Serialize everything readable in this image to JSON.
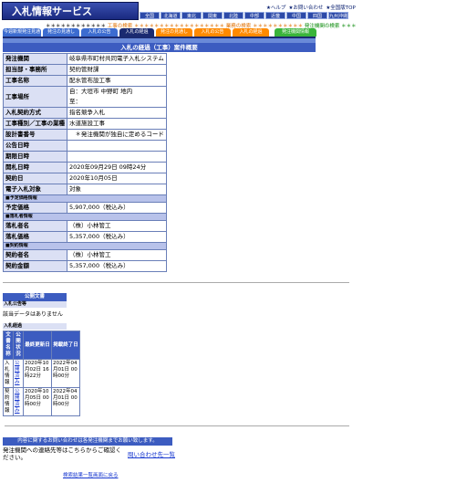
{
  "header": {
    "logo": "入札情報サービス",
    "top_links": [
      "★ヘルプ",
      "★お問い合わせ",
      "★全国版TOP"
    ],
    "regions": [
      "全国",
      "北海道",
      "東北",
      "関東",
      "北陸",
      "中部",
      "近畿",
      "中国",
      "四国",
      "九州沖縄"
    ],
    "stars_left": "＊＊＊＊＊＊＊＊＊＊＊＊",
    "stars_mid": "工事の検索",
    "stars_mid2": "＊＊＊＊＊＊＊＊＊＊＊＊＊＊＊＊＊＊",
    "stars_goods": "業務の検索",
    "stars_mid3": "＊＊＊＊＊＊＊＊＊＊",
    "stars_org": "発注機関の検索",
    "stars_end": "＊＊＊"
  },
  "tabs": [
    {
      "label": "今週新規発注見通し"
    },
    {
      "label": "発注の見通し"
    },
    {
      "label": "入札の公告"
    },
    {
      "label": "入札の経過"
    },
    {
      "label": "発注の見通し"
    },
    {
      "label": "入札の公告"
    },
    {
      "label": "入札の経過"
    },
    {
      "label": "発注機関情報"
    }
  ],
  "page_title": "入札の経過（工事）案件概要",
  "rows": {
    "agency": {
      "k": "発注機関",
      "v": "岐阜県市町村共同電子入札システム"
    },
    "dept": {
      "k": "担当部・事務所",
      "v": "契約管財課"
    },
    "name": {
      "k": "工事名称",
      "v": "配水管布設工事"
    },
    "place": {
      "k": "工事場所",
      "from": "自：大垣市 中野町 地内",
      "to": "至："
    },
    "method": {
      "k": "入札契約方式",
      "v": "指名競争入札"
    },
    "category": {
      "k": "工事種別／工事の業種",
      "v": "水道施設工事"
    },
    "design": {
      "k": "設計書番号",
      "v": "＊発注機関が独自に定めるコード"
    },
    "notice_date": {
      "k": "公告日時",
      "v": ""
    },
    "deadline": {
      "k": "期限日時",
      "v": ""
    },
    "open_date": {
      "k": "開札日時",
      "v": "2020年09月29日 09時24分"
    },
    "contract_date": {
      "k": "契約日",
      "v": "2020年10月05日"
    },
    "e_bid": {
      "k": "電子入札対象",
      "v": "対象"
    },
    "sec_price": "■予定価格情報",
    "est_price": {
      "k": "予定価格",
      "v": "5,907,000（税込み）"
    },
    "sec_winner": "■落札者情報",
    "winner": {
      "k": "落札者名",
      "v": "（株）小林管工"
    },
    "win_price": {
      "k": "落札価格",
      "v": "5,357,000（税込み）"
    },
    "sec_contract": "■契約情報",
    "contractor": {
      "k": "契約者名",
      "v": "（株）小林管工"
    },
    "amount": {
      "k": "契約金額",
      "v": "5,357,000（税込み）"
    }
  },
  "public_docs": {
    "heading": "公開文書",
    "announce_label": "入札公告等",
    "announce_note": "該当データはありません",
    "result_label": "入札経過",
    "columns": [
      "文書名称",
      "公開状況",
      "最終更新日",
      "掲載終了日"
    ],
    "docs": [
      {
        "name": "入札情報",
        "status": "公開済み",
        "updated": "2020年10月02日 16時22分",
        "end": "2022年04月01日 00時00分"
      },
      {
        "name": "契約情報",
        "status": "公開済み",
        "updated": "2020年10月05日 00時00分",
        "end": "2022年04月01日 00時00分"
      }
    ]
  },
  "contact": {
    "heading": "内容に関するお問い合わせは各発注機関までお願い致します。",
    "note": "発注機関への連絡先等はこちらからご確認ください。",
    "link": "問い合わせ先一覧"
  },
  "back_link": "検索結果一覧画面に戻る"
}
